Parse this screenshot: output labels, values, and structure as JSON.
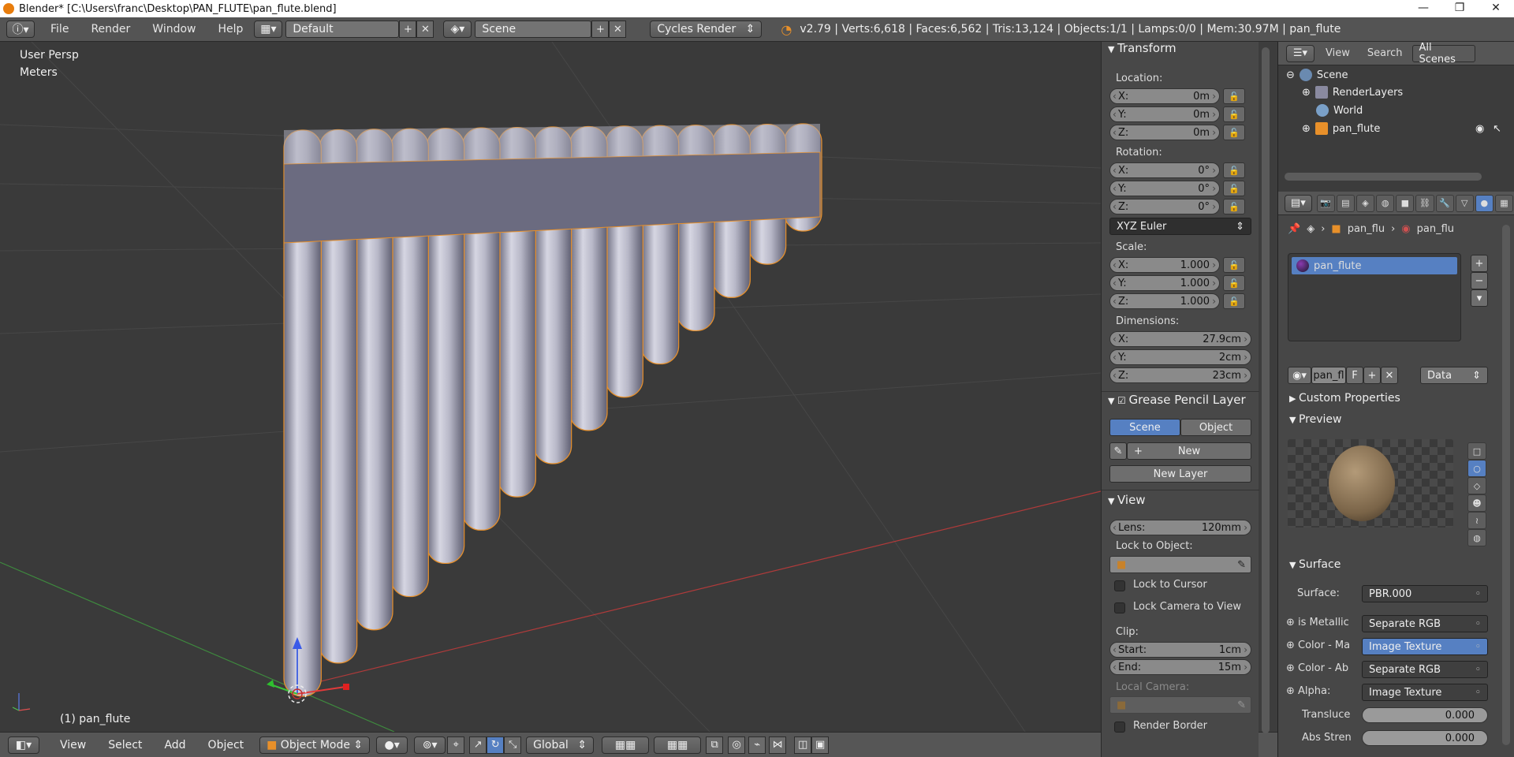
{
  "window": {
    "title": "Blender* [C:\\Users\\franc\\Desktop\\PAN_FLUTE\\pan_flute.blend]",
    "controls": [
      "—",
      "❐",
      "✕"
    ]
  },
  "info_header": {
    "menus": [
      "File",
      "Render",
      "Window",
      "Help"
    ],
    "screen_layout": "Default",
    "scene": "Scene",
    "render_engine": "Cycles Render",
    "stats": "v2.79 | Verts:6,618 | Faces:6,562 | Tris:13,124 | Objects:1/1 | Lamps:0/0 | Mem:30.97M | pan_flute"
  },
  "viewport": {
    "view_name": "User Persp",
    "units": "Meters",
    "active_object": "(1) pan_flute"
  },
  "bottom_toolbar": {
    "menus": [
      "View",
      "Select",
      "Add",
      "Object"
    ],
    "mode": "Object Mode",
    "orientation": "Global"
  },
  "npanel": {
    "transform": {
      "title": "Transform",
      "location_label": "Location:",
      "location": [
        {
          "k": "X:",
          "v": "0m"
        },
        {
          "k": "Y:",
          "v": "0m"
        },
        {
          "k": "Z:",
          "v": "0m"
        }
      ],
      "rotation_label": "Rotation:",
      "rotation": [
        {
          "k": "X:",
          "v": "0°"
        },
        {
          "k": "Y:",
          "v": "0°"
        },
        {
          "k": "Z:",
          "v": "0°"
        }
      ],
      "rotation_mode": "XYZ Euler",
      "scale_label": "Scale:",
      "scale": [
        {
          "k": "X:",
          "v": "1.000"
        },
        {
          "k": "Y:",
          "v": "1.000"
        },
        {
          "k": "Z:",
          "v": "1.000"
        }
      ],
      "dimensions_label": "Dimensions:",
      "dimensions": [
        {
          "k": "X:",
          "v": "27.9cm"
        },
        {
          "k": "Y:",
          "v": "2cm"
        },
        {
          "k": "Z:",
          "v": "23cm"
        }
      ]
    },
    "grease_pencil": {
      "title": "Grease Pencil Layer",
      "tab_scene": "Scene",
      "tab_object": "Object",
      "new_label": "New",
      "new_layer_label": "New Layer"
    },
    "view": {
      "title": "View",
      "lens_label": "Lens:",
      "lens_value": "120mm",
      "lock_to_object_label": "Lock to Object:",
      "lock_to_cursor": "Lock to Cursor",
      "lock_camera_to_view": "Lock Camera to View",
      "clip_label": "Clip:",
      "clip_start_label": "Start:",
      "clip_start": "1cm",
      "clip_end_label": "End:",
      "clip_end": "15m",
      "local_camera_label": "Local Camera:",
      "render_border": "Render Border"
    }
  },
  "outliner": {
    "view_menu": "View",
    "search_menu": "Search",
    "filter": "All Scenes",
    "items": [
      {
        "label": "Scene",
        "indent": 0
      },
      {
        "label": "RenderLayers",
        "indent": 1
      },
      {
        "label": "World",
        "indent": 1
      },
      {
        "label": "pan_flute",
        "indent": 1
      }
    ]
  },
  "properties": {
    "breadcrumb_object": "pan_flu",
    "breadcrumb_material": "pan_flu",
    "material_slot": "pan_flute",
    "material_name_field": "pan_fl",
    "fake_user": "F",
    "link_type": "Data",
    "custom_properties": "Custom Properties",
    "preview": "Preview",
    "surface_section": "Surface",
    "surface_label": "Surface:",
    "surface_value": "PBR.000",
    "inputs": [
      {
        "label": "is Metallic",
        "value": "Separate RGB",
        "selected": false
      },
      {
        "label": "Color - Ma",
        "value": "Image Texture",
        "selected": true
      },
      {
        "label": "Color - Ab",
        "value": "Separate RGB",
        "selected": false
      },
      {
        "label": "Alpha:",
        "value": "Image Texture",
        "selected": false
      }
    ],
    "sliders": [
      {
        "label": "Transluce",
        "value": "0.000"
      },
      {
        "label": "Abs Stren",
        "value": "0.000"
      }
    ]
  },
  "colors": {
    "accent": "#5680c2",
    "object_outline": "#e8902a",
    "flute": "#b8b8c8"
  }
}
